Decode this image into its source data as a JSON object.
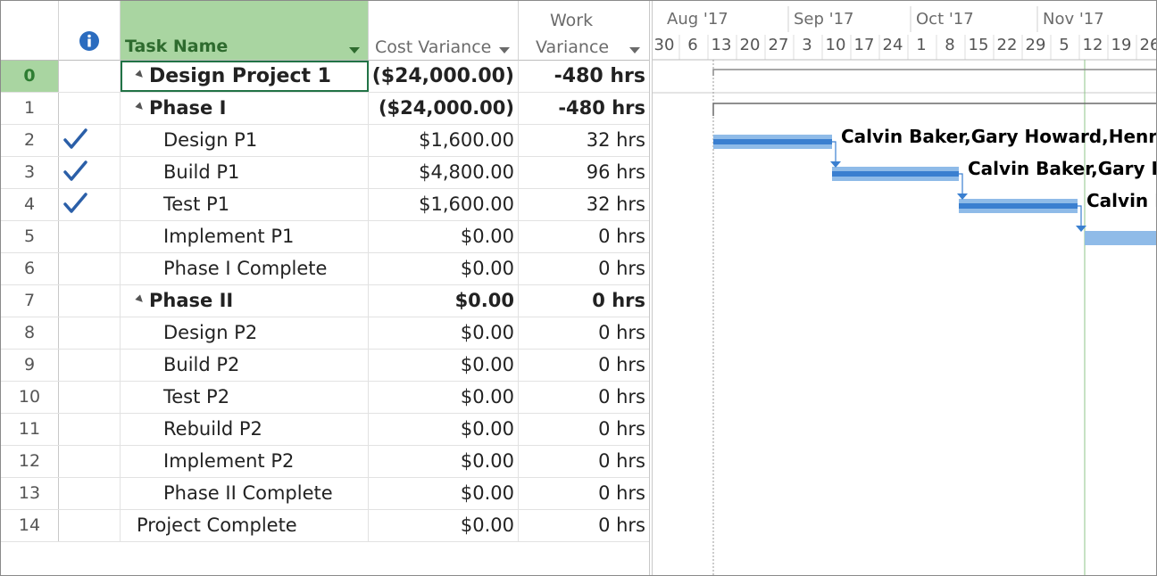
{
  "columns": {
    "info_icon": "info-icon",
    "task_name": "Task Name",
    "cost_variance": "Cost Variance",
    "work_variance_line1": "Work",
    "work_variance_line2": "Variance"
  },
  "timescale": {
    "months": [
      "Aug '17",
      "Sep '17",
      "Oct '17",
      "Nov '17"
    ],
    "days": [
      "30",
      "6",
      "13",
      "20",
      "27",
      "3",
      "10",
      "17",
      "24",
      "1",
      "8",
      "15",
      "22",
      "29",
      "5",
      "12",
      "19",
      "26"
    ]
  },
  "tasks": [
    {
      "id": "0",
      "name": "Design Project 1",
      "cost": "($24,000.00)",
      "work": "-480 hrs",
      "bold": true,
      "summary": true,
      "indent": 0,
      "done": false
    },
    {
      "id": "1",
      "name": "Phase I",
      "cost": "($24,000.00)",
      "work": "-480 hrs",
      "bold": true,
      "summary": true,
      "indent": 1,
      "done": false
    },
    {
      "id": "2",
      "name": "Design P1",
      "cost": "$1,600.00",
      "work": "32 hrs",
      "bold": false,
      "summary": false,
      "indent": 2,
      "done": true
    },
    {
      "id": "3",
      "name": "Build P1",
      "cost": "$4,800.00",
      "work": "96 hrs",
      "bold": false,
      "summary": false,
      "indent": 2,
      "done": true
    },
    {
      "id": "4",
      "name": "Test P1",
      "cost": "$1,600.00",
      "work": "32 hrs",
      "bold": false,
      "summary": false,
      "indent": 2,
      "done": true
    },
    {
      "id": "5",
      "name": "Implement P1",
      "cost": "$0.00",
      "work": "0 hrs",
      "bold": false,
      "summary": false,
      "indent": 2,
      "done": false
    },
    {
      "id": "6",
      "name": "Phase I Complete",
      "cost": "$0.00",
      "work": "0 hrs",
      "bold": false,
      "summary": false,
      "indent": 2,
      "done": false
    },
    {
      "id": "7",
      "name": "Phase II",
      "cost": "$0.00",
      "work": "0 hrs",
      "bold": true,
      "summary": true,
      "indent": 1,
      "done": false
    },
    {
      "id": "8",
      "name": "Design P2",
      "cost": "$0.00",
      "work": "0 hrs",
      "bold": false,
      "summary": false,
      "indent": 2,
      "done": false
    },
    {
      "id": "9",
      "name": "Build P2",
      "cost": "$0.00",
      "work": "0 hrs",
      "bold": false,
      "summary": false,
      "indent": 2,
      "done": false
    },
    {
      "id": "10",
      "name": "Test P2",
      "cost": "$0.00",
      "work": "0 hrs",
      "bold": false,
      "summary": false,
      "indent": 2,
      "done": false
    },
    {
      "id": "11",
      "name": "Rebuild P2",
      "cost": "$0.00",
      "work": "0 hrs",
      "bold": false,
      "summary": false,
      "indent": 2,
      "done": false
    },
    {
      "id": "12",
      "name": "Implement P2",
      "cost": "$0.00",
      "work": "0 hrs",
      "bold": false,
      "summary": false,
      "indent": 2,
      "done": false
    },
    {
      "id": "13",
      "name": "Phase II Complete",
      "cost": "$0.00",
      "work": "0 hrs",
      "bold": false,
      "summary": false,
      "indent": 2,
      "done": false
    },
    {
      "id": "14",
      "name": "Project Complete",
      "cost": "$0.00",
      "work": "0 hrs",
      "bold": false,
      "summary": false,
      "indent": 1,
      "done": false
    }
  ],
  "gantt": {
    "resource_labels": [
      "Calvin Baker,Gary Howard,Henry",
      "Calvin Baker,Gary H",
      "Calvin B"
    ]
  },
  "colors": {
    "selected_header": "#a9d5a1",
    "selected_header_text": "#2e7d32",
    "bar_light": "#8fbbe8",
    "bar_dark": "#3a7fd0",
    "info_blue": "#2b6cbf"
  }
}
